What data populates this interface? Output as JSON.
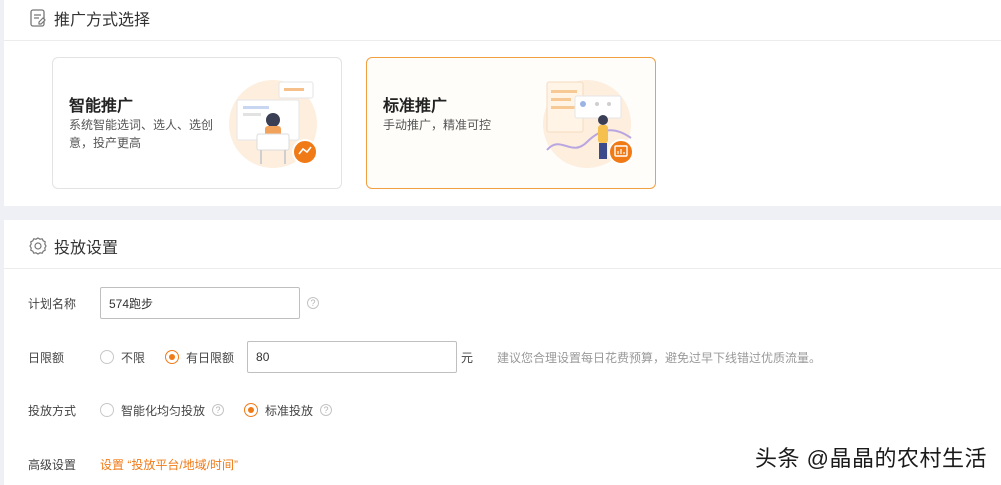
{
  "promo_section": {
    "title": "推广方式选择",
    "cards": [
      {
        "title": "智能推广",
        "desc": "系统智能选词、选人、选创意，投产更高",
        "selected": false
      },
      {
        "title": "标准推广",
        "desc": "手动推广，精准可控",
        "selected": true
      }
    ]
  },
  "settings": {
    "title": "投放设置",
    "plan_name": {
      "label": "计划名称",
      "value": "574跑步"
    },
    "daily_limit": {
      "label": "日限额",
      "options": [
        "不限",
        "有日限额"
      ],
      "selected": "有日限额",
      "value": "80",
      "unit": "元",
      "hint": "建议您合理设置每日花费预算，避免过早下线错过优质流量。"
    },
    "delivery": {
      "label": "投放方式",
      "options": [
        "智能化均匀投放",
        "标准投放"
      ],
      "selected": "标准投放"
    },
    "advanced": {
      "label": "高级设置",
      "link": "设置 “投放平台/地域/时间”"
    }
  },
  "watermark": "头条 @晶晶的农村生活",
  "colors": {
    "accent": "#f07a16",
    "selected_border": "#f0a040"
  }
}
